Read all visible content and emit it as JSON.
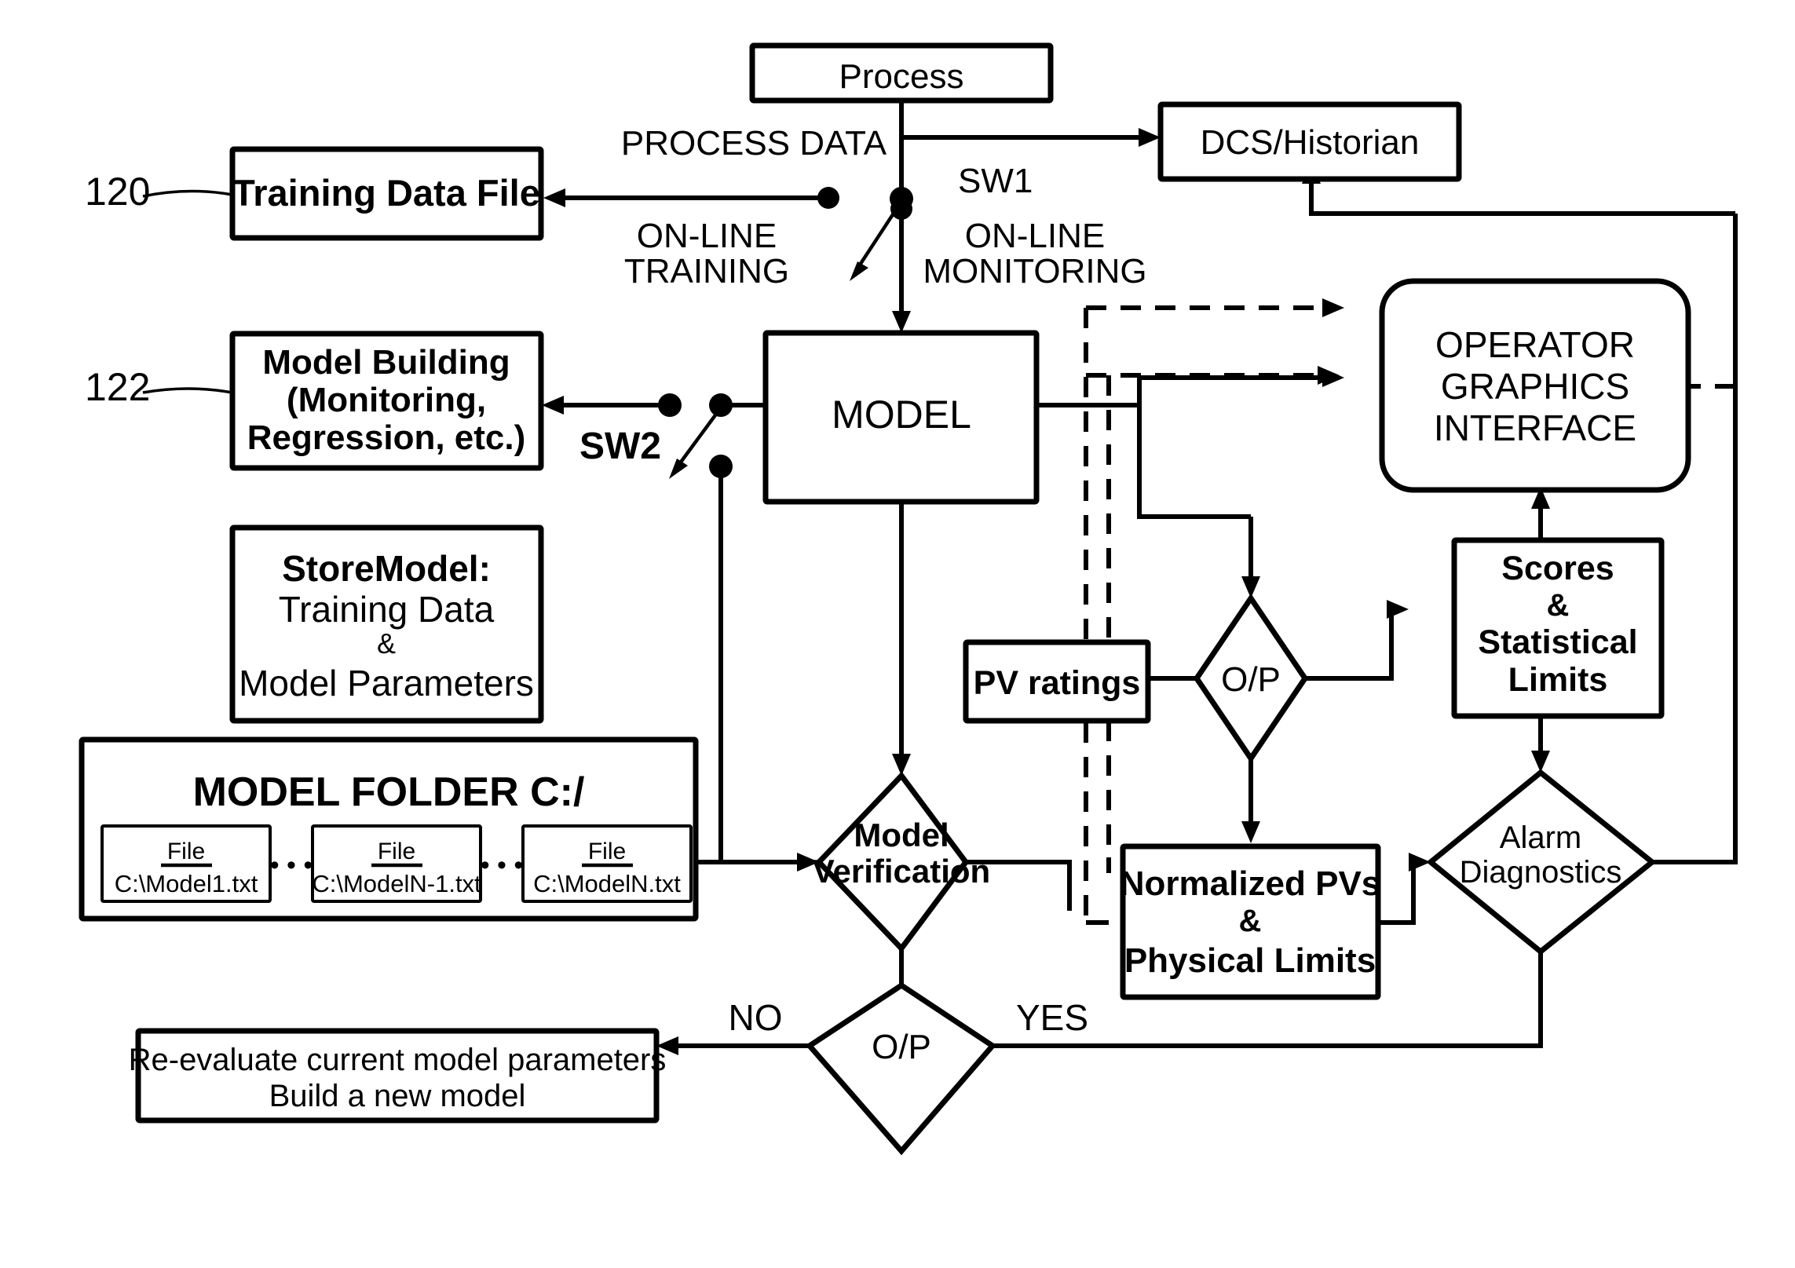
{
  "diagram": {
    "title": "Process Monitoring Model Flow Diagram",
    "reference_numerals": {
      "training_data_file": "120",
      "model_building": "122"
    },
    "nodes": {
      "process": "Process",
      "dcs_historian": "DCS/Historian",
      "training_data_file": "Training Data File",
      "model_building_l1": "Model Building",
      "model_building_l2": "(Monitoring,",
      "model_building_l3": "Regression, etc.)",
      "store_model_l1": "StoreModel:",
      "store_model_l2": "Training Data",
      "store_model_l3": "&",
      "store_model_l4": "Model Parameters",
      "model_folder_title": "MODEL FOLDER C:/",
      "model": "MODEL",
      "model_verification_l1": "Model",
      "model_verification_l2": "Verification",
      "pv_ratings": "PV ratings",
      "op_mid": "O/P",
      "op_bottom": "O/P",
      "scores_l1": "Scores",
      "scores_l2": "&",
      "scores_l3": "Statistical",
      "scores_l4": "Limits",
      "normalized_l1": "Normalized PVs",
      "normalized_l2": "&",
      "normalized_l3": "Physical Limits",
      "alarm_l1": "Alarm",
      "alarm_l2": "Diagnostics",
      "operator_l1": "OPERATOR",
      "operator_l2": "GRAPHICS",
      "operator_l3": "INTERFACE",
      "reevaluate_l1": "Re-evaluate current model parameters",
      "reevaluate_l2": "Build a new model"
    },
    "files": [
      {
        "label": "File",
        "path": "C:\\Model1.txt"
      },
      {
        "label": "File",
        "path": "C:\\ModelN-1.txt"
      },
      {
        "label": "File",
        "path": "C:\\ModelN.txt"
      }
    ],
    "ellipsis": "• • •",
    "edge_labels": {
      "process_data": "PROCESS DATA",
      "sw1": "SW1",
      "sw2": "SW2",
      "online_training_l1": "ON-LINE",
      "online_training_l2": "TRAINING",
      "online_monitoring_l1": "ON-LINE",
      "online_monitoring_l2": "MONITORING",
      "no": "NO",
      "yes": "YES"
    },
    "colors": {
      "ink": "#000000",
      "paper": "#ffffff"
    }
  }
}
